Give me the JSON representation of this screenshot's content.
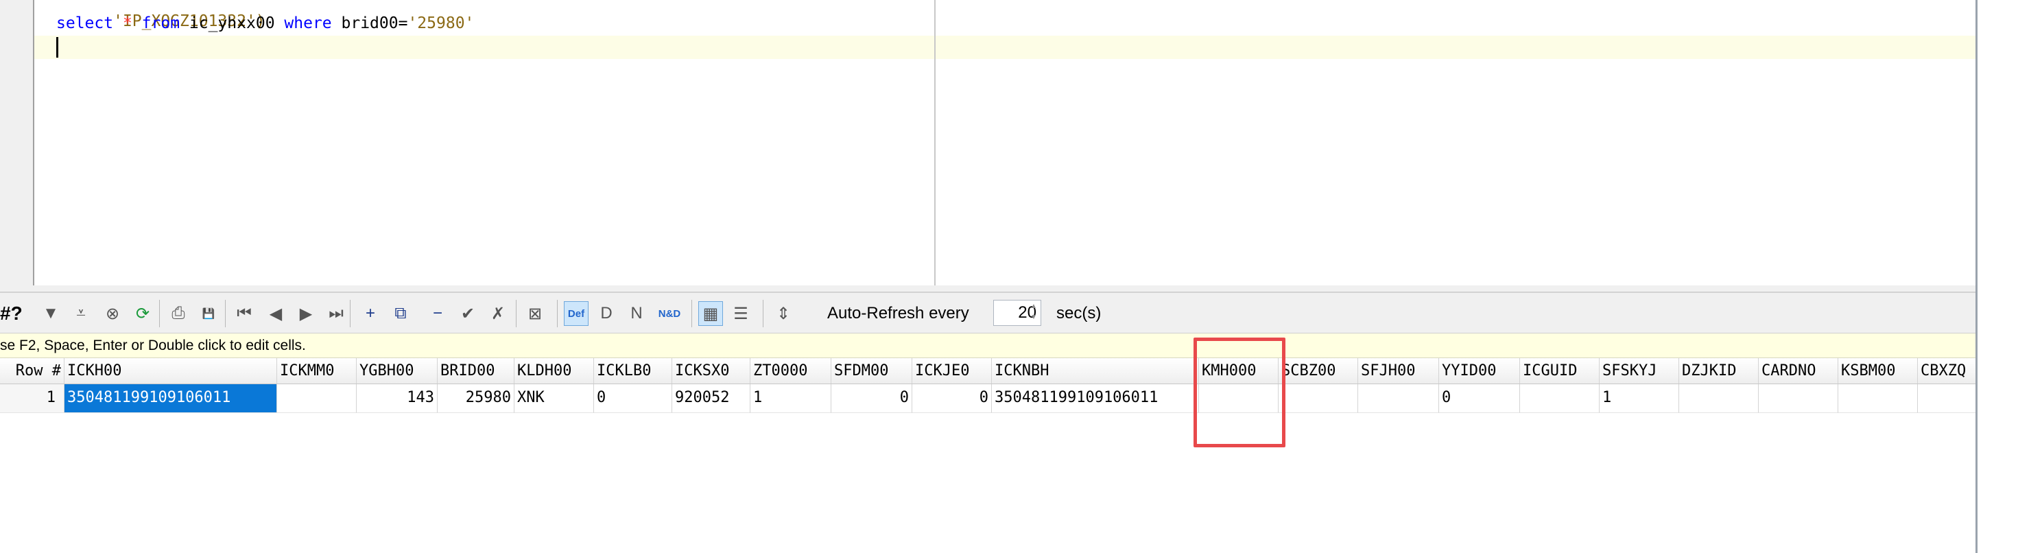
{
  "editor": {
    "line0": {
      "text": "'IP_XQGZ101332')"
    },
    "line1": {
      "select": "select",
      "star": "*",
      "from": "from",
      "table": "ic_yhxx00",
      "where": "where",
      "column": "brid00=",
      "value": "'25980'"
    }
  },
  "toolbar": {
    "row_count_label": "#?",
    "buttons": [
      {
        "name": "filter-icon",
        "glyph": "▼"
      },
      {
        "name": "sort-icon",
        "glyph": "⩡"
      },
      {
        "name": "cancel-icon",
        "glyph": "⊗"
      },
      {
        "name": "refresh-icon",
        "glyph": "⟳"
      },
      {
        "name": "print-icon",
        "glyph": "⎙"
      },
      {
        "name": "save-icon",
        "glyph": "💾"
      },
      {
        "name": "first-record-icon",
        "glyph": "⏮"
      },
      {
        "name": "prior-record-icon",
        "glyph": "◀"
      },
      {
        "name": "next-record-icon",
        "glyph": "▶"
      },
      {
        "name": "last-record-icon",
        "glyph": "⏭"
      },
      {
        "name": "insert-record-icon",
        "glyph": "+"
      },
      {
        "name": "duplicate-record-icon",
        "glyph": "⧉"
      },
      {
        "name": "delete-record-icon",
        "glyph": "−"
      },
      {
        "name": "post-edit-icon",
        "glyph": "✔"
      },
      {
        "name": "cancel-edit-icon",
        "glyph": "✗"
      },
      {
        "name": "clear-icon",
        "glyph": "⊠"
      },
      {
        "name": "set-default-icon",
        "glyph": "Def"
      },
      {
        "name": "set-d-icon",
        "glyph": "D"
      },
      {
        "name": "set-null-icon",
        "glyph": "N"
      },
      {
        "name": "set-n-d-icon",
        "glyph": "N&D"
      },
      {
        "name": "grid-view-icon",
        "glyph": "▦"
      },
      {
        "name": "form-view-icon",
        "glyph": "☰"
      },
      {
        "name": "record-view-icon",
        "glyph": "⇕"
      }
    ],
    "auto_refresh_label": "Auto-Refresh every",
    "auto_refresh_value": "20",
    "sec_label": "sec(s)"
  },
  "hint": {
    "text": "se F2, Space, Enter or Double click to edit cells."
  },
  "grid": {
    "columns": [
      "Row #",
      "ICKH00",
      "ICKMM0",
      "YGBH00",
      "BRID00",
      "KLDH00",
      "ICKLB0",
      "ICKSX0",
      "ZT0000",
      "SFDM00",
      "ICKJE0",
      "ICKNBH",
      "KMH000",
      "SCBZ00",
      "SFJH00",
      "YYID00",
      "ICGUID",
      "SFSKYJ",
      "DZJKID",
      "CARDNO",
      "KSBM00",
      "CBXZQ"
    ],
    "rows": [
      [
        "1",
        "350481199109106011",
        "",
        "143",
        "25980",
        "XNK",
        "0",
        "920052",
        "1",
        "0",
        "0",
        "350481199109106011",
        "",
        "",
        "",
        "0",
        "",
        "1",
        "",
        "",
        "",
        ""
      ]
    ],
    "selected_cell": {
      "row": 0,
      "column": "ICKH00"
    },
    "highlighted_column": "KMH000"
  },
  "colors": {
    "keyword": "#0000ff",
    "string": "#8b6914",
    "symbol": "#ff3333",
    "selection": "#0a78d7",
    "highlight_box": "#e8494b",
    "hint_background": "#ffffe1"
  }
}
